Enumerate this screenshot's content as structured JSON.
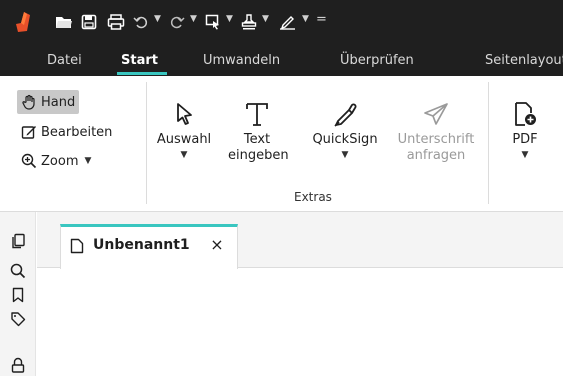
{
  "quick_access": {
    "customize_symbol": "="
  },
  "menu": {
    "tabs": [
      {
        "label": "Datei"
      },
      {
        "label": "Start"
      },
      {
        "label": "Umwandeln"
      },
      {
        "label": "Überprüfen"
      },
      {
        "label": "Seitenlayout"
      }
    ],
    "active_index": 1
  },
  "ribbon": {
    "tools_small": [
      {
        "label": "Hand"
      },
      {
        "label": "Bearbeiten"
      },
      {
        "label": "Zoom"
      }
    ],
    "extras": {
      "label": "Extras",
      "buttons": [
        {
          "label": "Auswahl"
        },
        {
          "label_line1": "Text",
          "label_line2": "eingeben"
        },
        {
          "label": "QuickSign"
        },
        {
          "label_line1": "Unterschrift",
          "label_line2": "anfragen"
        }
      ]
    },
    "pdf_button": {
      "label": "PDF"
    }
  },
  "document_tabs": [
    {
      "title": "Unbenannt1",
      "close_symbol": "×"
    }
  ],
  "colors": {
    "accent": "#39c6c0",
    "title_bar": "#1f1f1f",
    "logo": "#e8502a"
  }
}
